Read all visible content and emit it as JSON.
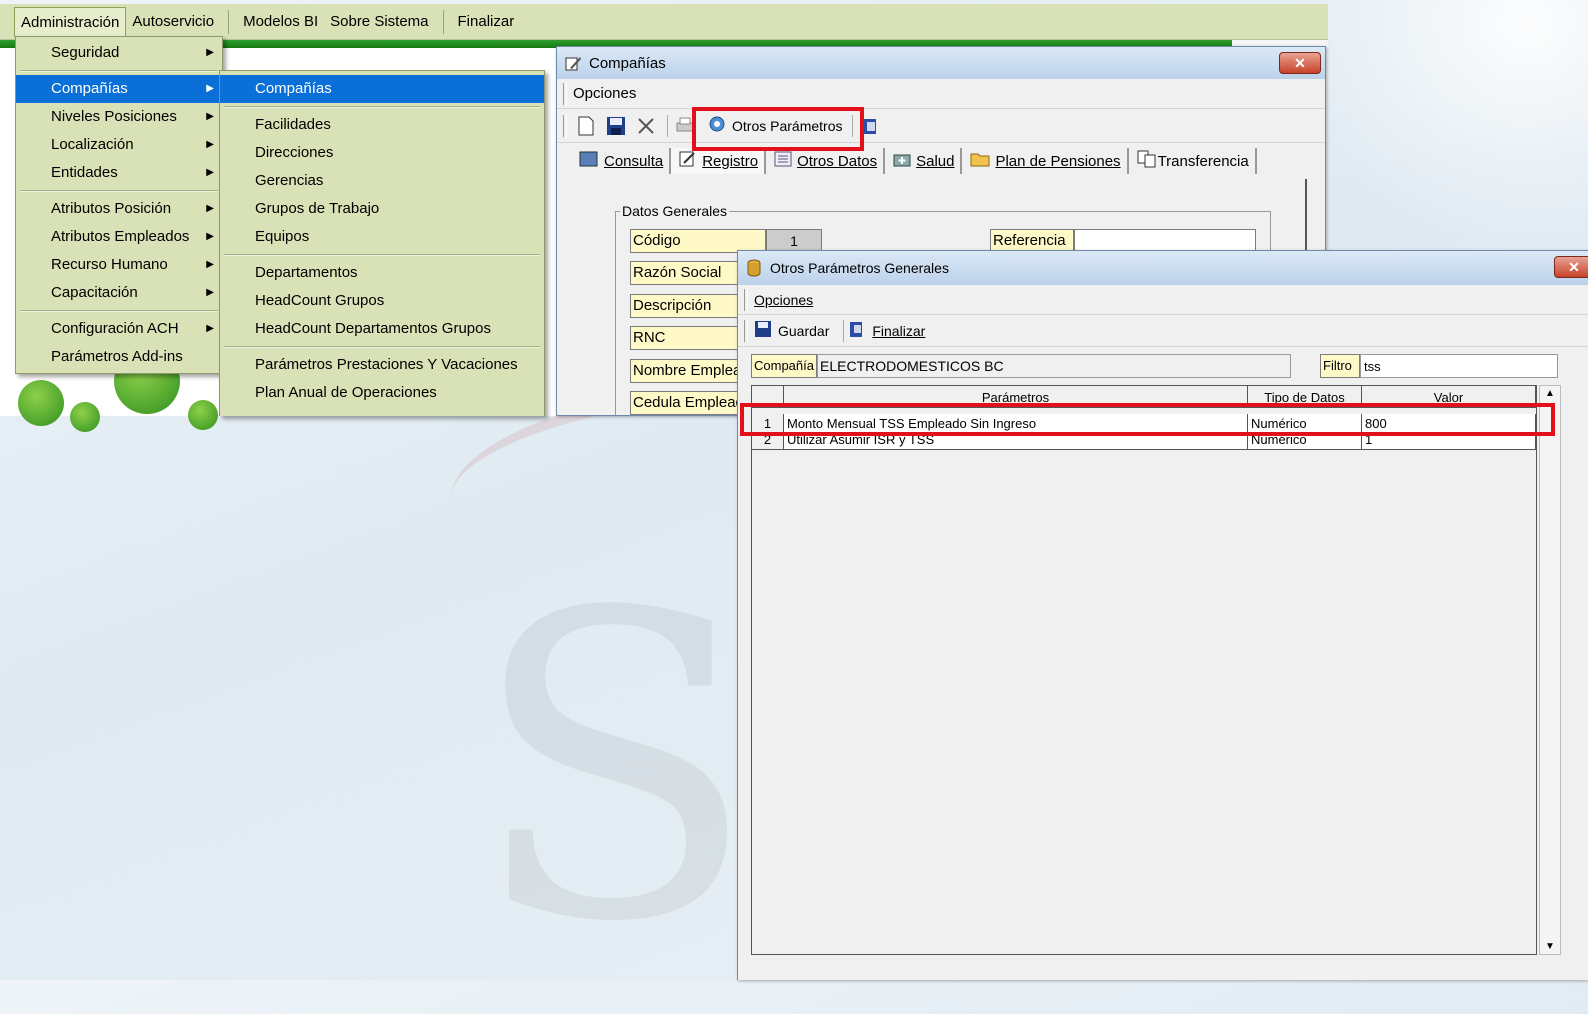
{
  "menubar": {
    "items": [
      "Administración",
      "Autoservicio",
      "Modelos BI",
      "Sobre Sistema",
      "Finalizar"
    ]
  },
  "admin_menu": {
    "items": [
      {
        "label": "Seguridad",
        "submenu": true
      },
      {
        "label": "Compañías",
        "submenu": true,
        "selected": true
      },
      {
        "label": "Niveles Posiciones",
        "submenu": true
      },
      {
        "label": "Localización",
        "submenu": true
      },
      {
        "label": "Entidades",
        "submenu": true
      },
      {
        "label": "Atributos Posición",
        "submenu": true
      },
      {
        "label": "Atributos Empleados",
        "submenu": true
      },
      {
        "label": "Recurso Humano",
        "submenu": true
      },
      {
        "label": "Capacitación",
        "submenu": true
      },
      {
        "label": "Configuración ACH",
        "submenu": true
      },
      {
        "label": "Parámetros Add-ins",
        "submenu": false
      }
    ]
  },
  "companias_submenu": {
    "items": [
      "Compañías",
      "Facilidades",
      "Direcciones",
      "Gerencias",
      "Grupos de Trabajo",
      "Equipos",
      "Departamentos",
      "HeadCount Grupos",
      "HeadCount Departamentos Grupos",
      "Parámetros Prestaciones Y Vacaciones",
      "Plan Anual de Operaciones"
    ]
  },
  "companias_window": {
    "title": "Compañías",
    "close": "✕",
    "options": "Opciones",
    "otros_parametros": "Otros Parámetros",
    "tabs": [
      "Consulta",
      "Registro",
      "Otros Datos",
      "Salud",
      "Plan de Pensiones",
      "Transferencia"
    ],
    "group_title": "Datos Generales",
    "fields": {
      "codigo_label": "Código",
      "codigo_value": "1",
      "razon_label": "Razón Social",
      "descripcion_label": "Descripción",
      "rnc_label": "RNC",
      "nombre_label": "Nombre Empleador",
      "cedula_label": "Cedula Empleador",
      "referencia_label": "Referencia"
    }
  },
  "otros_window": {
    "title": "Otros Parámetros Generales",
    "close": "✕",
    "options": "Opciones",
    "guardar": "Guardar",
    "finalizar": "Finalizar",
    "compania_label": "Compañía",
    "compania_value": "ELECTRODOMESTICOS BC",
    "filtro_label": "Filtro",
    "filtro_value": "tss",
    "grid": {
      "headers": [
        "",
        "Parámetros",
        "Tipo de Datos",
        "Valor"
      ],
      "rows": [
        [
          "1",
          "Monto Mensual TSS Empleado Sin Ingreso",
          "Numérico",
          "800"
        ],
        [
          "2",
          "Utilizar Asumir ISR y TSS",
          "Numérico",
          "1"
        ]
      ]
    }
  },
  "colors": {
    "highlight": "#e3101c",
    "menu_bg": "#d8e2b6",
    "selected": "#0a6fd6",
    "field_yellow": "#fff9c8"
  }
}
